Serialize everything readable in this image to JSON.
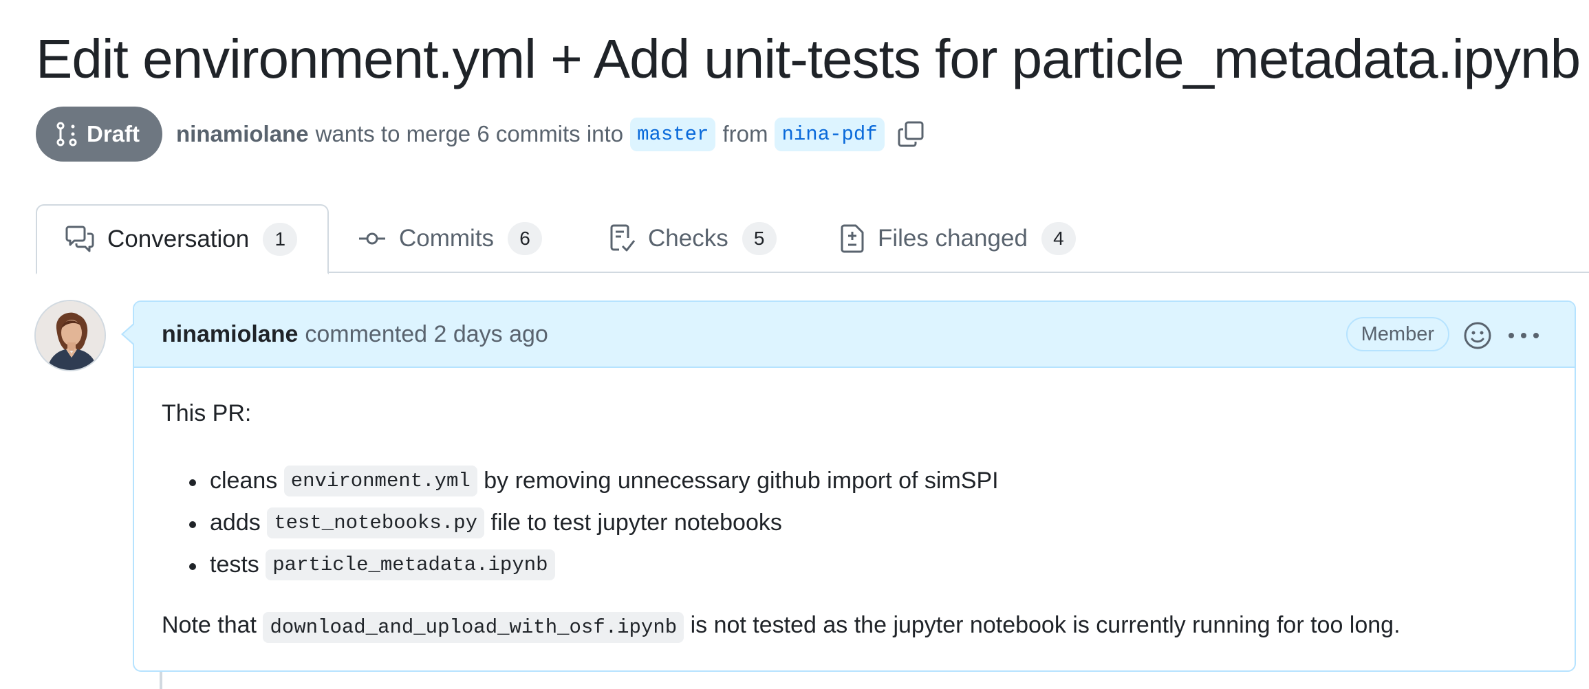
{
  "pr": {
    "title": "Edit environment.yml + Add unit-tests for particle_metadata.ipynb",
    "state": "Draft",
    "author": "ninamiolane",
    "merge_text_1": "wants to merge 6 commits into",
    "base_branch": "master",
    "merge_text_2": "from",
    "head_branch": "nina-pdf"
  },
  "tabs": [
    {
      "label": "Conversation",
      "count": "1",
      "icon": "comment-discussion-icon"
    },
    {
      "label": "Commits",
      "count": "6",
      "icon": "git-commit-icon"
    },
    {
      "label": "Checks",
      "count": "5",
      "icon": "checklist-icon"
    },
    {
      "label": "Files changed",
      "count": "4",
      "icon": "file-diff-icon"
    }
  ],
  "comment": {
    "author": "ninamiolane",
    "action": "commented 2 days ago",
    "badge": "Member",
    "intro": "This PR:",
    "items": [
      {
        "prefix": "cleans",
        "code": "environment.yml",
        "suffix": "by removing unnecessary github import of simSPI"
      },
      {
        "prefix": "adds",
        "code": "test_notebooks.py",
        "suffix": "file to test jupyter notebooks"
      },
      {
        "prefix": "tests",
        "code": "particle_metadata.ipynb",
        "suffix": ""
      }
    ],
    "note_prefix": "Note that",
    "note_code": "download_and_upload_with_osf.ipynb",
    "note_suffix": "is not tested as the jupyter notebook is currently running for too long."
  },
  "colors": {
    "draft": "#6e7781",
    "branch_bg": "#ddf4ff",
    "branch_text": "#0969da",
    "comment_header_bg": "#ddf4ff",
    "comment_border": "#b6e3ff"
  }
}
